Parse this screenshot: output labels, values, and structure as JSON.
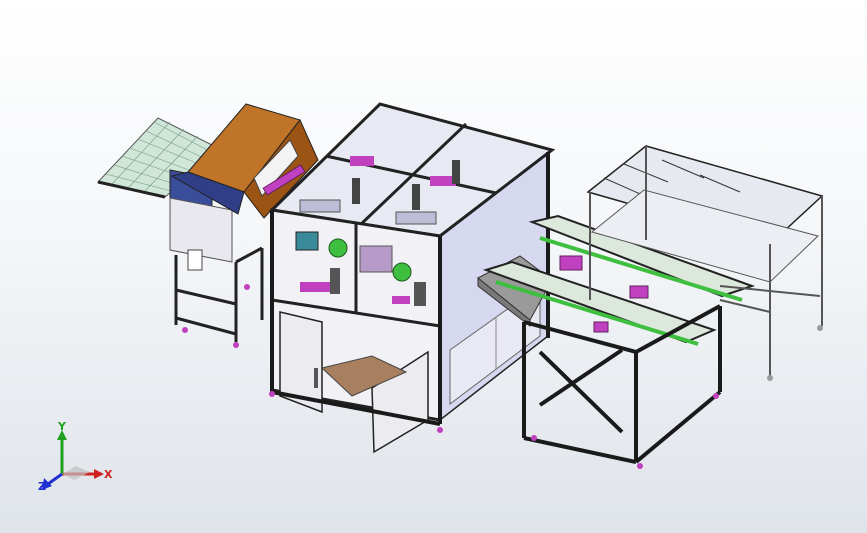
{
  "scene": {
    "background_top": "#ffffff",
    "background_bottom": "#dfe4ea",
    "frame_color": "#1a1a1a",
    "panel_color": "#d6d8f0",
    "accent_pink": "#c040c0",
    "accent_green": "#3fbf3f",
    "infeed_body_color": "#3a4d9a",
    "infeed_cover_color": "#b86a1e"
  },
  "triad": {
    "x_label": "X",
    "y_label": "Y",
    "z_label": "Z",
    "x_color": "#d02020",
    "y_color": "#20a020",
    "z_color": "#2030d0"
  }
}
